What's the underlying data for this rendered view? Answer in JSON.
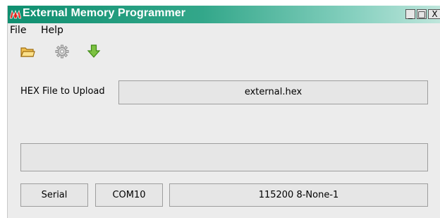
{
  "window": {
    "title": "External Memory Programmer",
    "app_icon": "microchip-logo-icon",
    "controls": {
      "minimize": "_",
      "maximize": "□",
      "close": "X"
    }
  },
  "menu": {
    "items": [
      "File",
      "Help"
    ]
  },
  "toolbar": {
    "icons": [
      "open-folder-icon",
      "settings-gear-icon",
      "download-arrow-icon"
    ]
  },
  "hex_file": {
    "label": "HEX File to Upload",
    "value": "external.hex"
  },
  "status": {
    "text": ""
  },
  "connection": {
    "type": "Serial",
    "port": "COM10",
    "settings": "115200 8-None-1"
  },
  "colors": {
    "titlebar_start": "#0f8f70",
    "titlebar_end": "#bfe6dc",
    "panel": "#ececec",
    "field": "#e6e6e6",
    "logo": "#e2231a"
  }
}
